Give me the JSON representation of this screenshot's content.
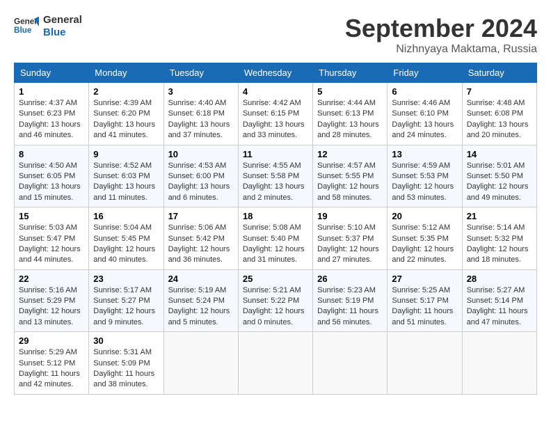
{
  "logo": {
    "line1": "General",
    "line2": "Blue"
  },
  "title": "September 2024",
  "location": "Nizhnyaya Maktama, Russia",
  "headers": [
    "Sunday",
    "Monday",
    "Tuesday",
    "Wednesday",
    "Thursday",
    "Friday",
    "Saturday"
  ],
  "weeks": [
    [
      {
        "day": "1",
        "info": "Sunrise: 4:37 AM\nSunset: 6:23 PM\nDaylight: 13 hours\nand 46 minutes."
      },
      {
        "day": "2",
        "info": "Sunrise: 4:39 AM\nSunset: 6:20 PM\nDaylight: 13 hours\nand 41 minutes."
      },
      {
        "day": "3",
        "info": "Sunrise: 4:40 AM\nSunset: 6:18 PM\nDaylight: 13 hours\nand 37 minutes."
      },
      {
        "day": "4",
        "info": "Sunrise: 4:42 AM\nSunset: 6:15 PM\nDaylight: 13 hours\nand 33 minutes."
      },
      {
        "day": "5",
        "info": "Sunrise: 4:44 AM\nSunset: 6:13 PM\nDaylight: 13 hours\nand 28 minutes."
      },
      {
        "day": "6",
        "info": "Sunrise: 4:46 AM\nSunset: 6:10 PM\nDaylight: 13 hours\nand 24 minutes."
      },
      {
        "day": "7",
        "info": "Sunrise: 4:48 AM\nSunset: 6:08 PM\nDaylight: 13 hours\nand 20 minutes."
      }
    ],
    [
      {
        "day": "8",
        "info": "Sunrise: 4:50 AM\nSunset: 6:05 PM\nDaylight: 13 hours\nand 15 minutes."
      },
      {
        "day": "9",
        "info": "Sunrise: 4:52 AM\nSunset: 6:03 PM\nDaylight: 13 hours\nand 11 minutes."
      },
      {
        "day": "10",
        "info": "Sunrise: 4:53 AM\nSunset: 6:00 PM\nDaylight: 13 hours\nand 6 minutes."
      },
      {
        "day": "11",
        "info": "Sunrise: 4:55 AM\nSunset: 5:58 PM\nDaylight: 13 hours\nand 2 minutes."
      },
      {
        "day": "12",
        "info": "Sunrise: 4:57 AM\nSunset: 5:55 PM\nDaylight: 12 hours\nand 58 minutes."
      },
      {
        "day": "13",
        "info": "Sunrise: 4:59 AM\nSunset: 5:53 PM\nDaylight: 12 hours\nand 53 minutes."
      },
      {
        "day": "14",
        "info": "Sunrise: 5:01 AM\nSunset: 5:50 PM\nDaylight: 12 hours\nand 49 minutes."
      }
    ],
    [
      {
        "day": "15",
        "info": "Sunrise: 5:03 AM\nSunset: 5:47 PM\nDaylight: 12 hours\nand 44 minutes."
      },
      {
        "day": "16",
        "info": "Sunrise: 5:04 AM\nSunset: 5:45 PM\nDaylight: 12 hours\nand 40 minutes."
      },
      {
        "day": "17",
        "info": "Sunrise: 5:06 AM\nSunset: 5:42 PM\nDaylight: 12 hours\nand 36 minutes."
      },
      {
        "day": "18",
        "info": "Sunrise: 5:08 AM\nSunset: 5:40 PM\nDaylight: 12 hours\nand 31 minutes."
      },
      {
        "day": "19",
        "info": "Sunrise: 5:10 AM\nSunset: 5:37 PM\nDaylight: 12 hours\nand 27 minutes."
      },
      {
        "day": "20",
        "info": "Sunrise: 5:12 AM\nSunset: 5:35 PM\nDaylight: 12 hours\nand 22 minutes."
      },
      {
        "day": "21",
        "info": "Sunrise: 5:14 AM\nSunset: 5:32 PM\nDaylight: 12 hours\nand 18 minutes."
      }
    ],
    [
      {
        "day": "22",
        "info": "Sunrise: 5:16 AM\nSunset: 5:29 PM\nDaylight: 12 hours\nand 13 minutes."
      },
      {
        "day": "23",
        "info": "Sunrise: 5:17 AM\nSunset: 5:27 PM\nDaylight: 12 hours\nand 9 minutes."
      },
      {
        "day": "24",
        "info": "Sunrise: 5:19 AM\nSunset: 5:24 PM\nDaylight: 12 hours\nand 5 minutes."
      },
      {
        "day": "25",
        "info": "Sunrise: 5:21 AM\nSunset: 5:22 PM\nDaylight: 12 hours\nand 0 minutes."
      },
      {
        "day": "26",
        "info": "Sunrise: 5:23 AM\nSunset: 5:19 PM\nDaylight: 11 hours\nand 56 minutes."
      },
      {
        "day": "27",
        "info": "Sunrise: 5:25 AM\nSunset: 5:17 PM\nDaylight: 11 hours\nand 51 minutes."
      },
      {
        "day": "28",
        "info": "Sunrise: 5:27 AM\nSunset: 5:14 PM\nDaylight: 11 hours\nand 47 minutes."
      }
    ],
    [
      {
        "day": "29",
        "info": "Sunrise: 5:29 AM\nSunset: 5:12 PM\nDaylight: 11 hours\nand 42 minutes."
      },
      {
        "day": "30",
        "info": "Sunrise: 5:31 AM\nSunset: 5:09 PM\nDaylight: 11 hours\nand 38 minutes."
      },
      null,
      null,
      null,
      null,
      null
    ]
  ]
}
